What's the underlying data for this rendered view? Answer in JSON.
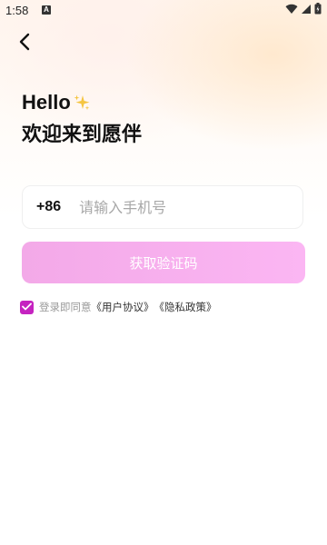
{
  "status_bar": {
    "time": "1:58",
    "notification_letter": "A",
    "icons": [
      "wifi-icon",
      "cell-signal-icon",
      "battery-icon"
    ]
  },
  "nav": {
    "back_icon": "chevron-left-icon"
  },
  "header": {
    "greeting": "Hello",
    "greeting_emoji": "sparkles-icon",
    "welcome": "欢迎来到愿伴"
  },
  "phone": {
    "country_code": "+86",
    "placeholder": "请输入手机号",
    "value": ""
  },
  "get_code_button": {
    "label": "获取验证码"
  },
  "agreement": {
    "checked": true,
    "prefix": "登录即同意",
    "user_agreement": "《用户协议》",
    "privacy_policy": "《隐私政策》"
  },
  "colors": {
    "accent": "#c523c0",
    "button_start": "#f3a9e8",
    "button_end": "#fbb6f3",
    "text_primary": "#111111",
    "placeholder": "#a8a8a8"
  }
}
